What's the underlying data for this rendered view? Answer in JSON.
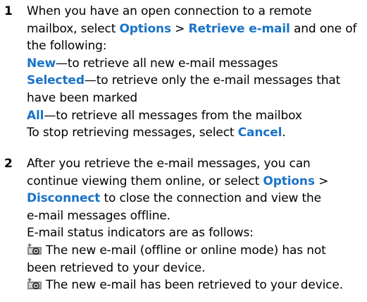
{
  "steps": [
    {
      "number": "1",
      "lines": [
        {
          "parts": [
            {
              "t": "When you have an open connection to a remote"
            }
          ]
        },
        {
          "parts": [
            {
              "t": "mailbox, select "
            },
            {
              "t": "Options",
              "hl": true
            },
            {
              "t": " > "
            },
            {
              "t": "Retrieve e-mail",
              "hl": true
            },
            {
              "t": " and one of"
            }
          ]
        },
        {
          "parts": [
            {
              "t": "the following:"
            }
          ]
        },
        {
          "parts": [
            {
              "t": "New",
              "hl": true
            },
            {
              "t": "—to retrieve all new e-mail messages"
            }
          ]
        },
        {
          "parts": [
            {
              "t": "Selected",
              "hl": true
            },
            {
              "t": "—to retrieve only the e-mail messages that"
            }
          ]
        },
        {
          "parts": [
            {
              "t": "have been marked"
            }
          ]
        },
        {
          "parts": [
            {
              "t": "All",
              "hl": true
            },
            {
              "t": "—to retrieve all messages from the mailbox"
            }
          ]
        },
        {
          "parts": [
            {
              "t": "To stop retrieving messages, select "
            },
            {
              "t": "Cancel",
              "hl": true
            },
            {
              "t": "."
            }
          ]
        }
      ]
    },
    {
      "number": "2",
      "lines": [
        {
          "parts": [
            {
              "t": "After you retrieve the e-mail messages, you can"
            }
          ]
        },
        {
          "parts": [
            {
              "t": "continue viewing them online, or select "
            },
            {
              "t": "Options",
              "hl": true
            },
            {
              "t": " >"
            }
          ]
        },
        {
          "parts": [
            {
              "t": "Disconnect",
              "hl": true
            },
            {
              "t": " to close the connection and view the"
            }
          ]
        },
        {
          "parts": [
            {
              "t": "e-mail messages offline."
            }
          ]
        },
        {
          "parts": [
            {
              "t": "E-mail status indicators are as follows:"
            }
          ]
        },
        {
          "icon": "new-email-not-retrieved-icon",
          "parts": [
            {
              "t": "The new e-mail (offline or online mode) has not"
            }
          ]
        },
        {
          "parts": [
            {
              "t": "been retrieved to your device."
            }
          ]
        },
        {
          "icon": "new-email-retrieved-icon",
          "parts": [
            {
              "t": "The new e-mail has been retrieved to your device."
            }
          ]
        }
      ]
    }
  ],
  "colors": {
    "highlight": "#1a73c8",
    "text": "#000000"
  }
}
